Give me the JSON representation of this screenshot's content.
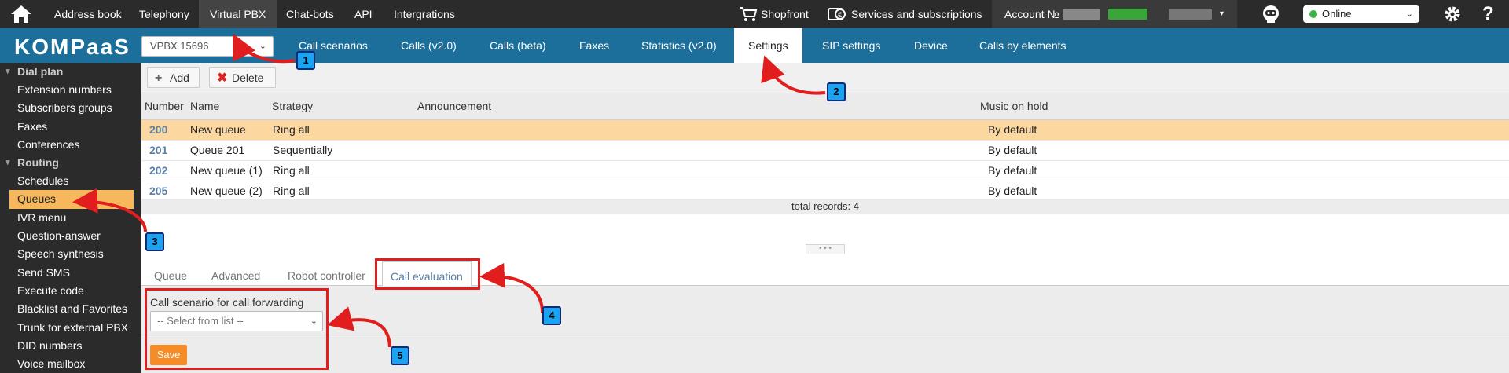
{
  "topbar": {
    "nav": [
      "Address book",
      "Telephony",
      "Virtual PBX",
      "Chat-bots",
      "API",
      "Intergrations"
    ],
    "active_nav": "Virtual PBX",
    "shopfront": "Shopfront",
    "services": "Services and subscriptions",
    "account_label": "Account №",
    "status": "Online"
  },
  "appbar": {
    "logo": "KOMPaaS",
    "vpbx_select": "VPBX 15696",
    "tabs": [
      "Call scenarios",
      "Calls (v2.0)",
      "Calls (beta)",
      "Faxes",
      "Statistics (v2.0)",
      "Settings",
      "SIP settings",
      "Device",
      "Calls by elements"
    ],
    "active_tab": "Settings"
  },
  "sidebar": {
    "group_dialplan": "Dial plan",
    "dialplan_items": [
      "Extension numbers",
      "Subscribers groups",
      "Faxes",
      "Conferences"
    ],
    "group_routing": "Routing",
    "routing_items": [
      "Schedules",
      "Queues",
      "IVR menu",
      "Question-answer",
      "Speech synthesis",
      "Send SMS",
      "Execute code",
      "Blacklist and Favorites",
      "Trunk for external PBX",
      "DID numbers",
      "Voice mailbox"
    ],
    "active_item": "Queues"
  },
  "toolbar": {
    "add_label": "Add",
    "delete_label": "Delete"
  },
  "grid": {
    "columns": [
      "Number",
      "Name",
      "Strategy",
      "Announcement",
      "Music on hold"
    ],
    "rows": [
      {
        "number": "200",
        "name": "New queue",
        "strategy": "Ring all",
        "announcement": "",
        "music": "By default"
      },
      {
        "number": "201",
        "name": "Queue 201",
        "strategy": "Sequentially",
        "announcement": "",
        "music": "By default"
      },
      {
        "number": "202",
        "name": "New queue (1)",
        "strategy": "Ring all",
        "announcement": "",
        "music": "By default"
      },
      {
        "number": "205",
        "name": "New queue (2)",
        "strategy": "Ring all",
        "announcement": "",
        "music": "By default"
      }
    ],
    "footer": "total records: 4"
  },
  "lower_tabs": {
    "tabs": [
      "Queue",
      "Advanced",
      "Robot controller",
      "Call evaluation"
    ],
    "active_tab": "Call evaluation"
  },
  "form": {
    "label": "Call scenario for call forwarding",
    "select_value": "-- Select from list --",
    "save_label": "Save"
  },
  "annotations": [
    "1",
    "2",
    "3",
    "4",
    "5"
  ],
  "colors": {
    "topbar_bg": "#2b2b2b",
    "appbar_bg": "#1d6f9b",
    "selected_row": "#fcd7a0",
    "sidebar_active": "#f7b85d",
    "save_button": "#f58c25",
    "annotation_red": "#e21d1d",
    "badge_blue": "#1aa3f0",
    "online_dot": "#3bb54a"
  }
}
